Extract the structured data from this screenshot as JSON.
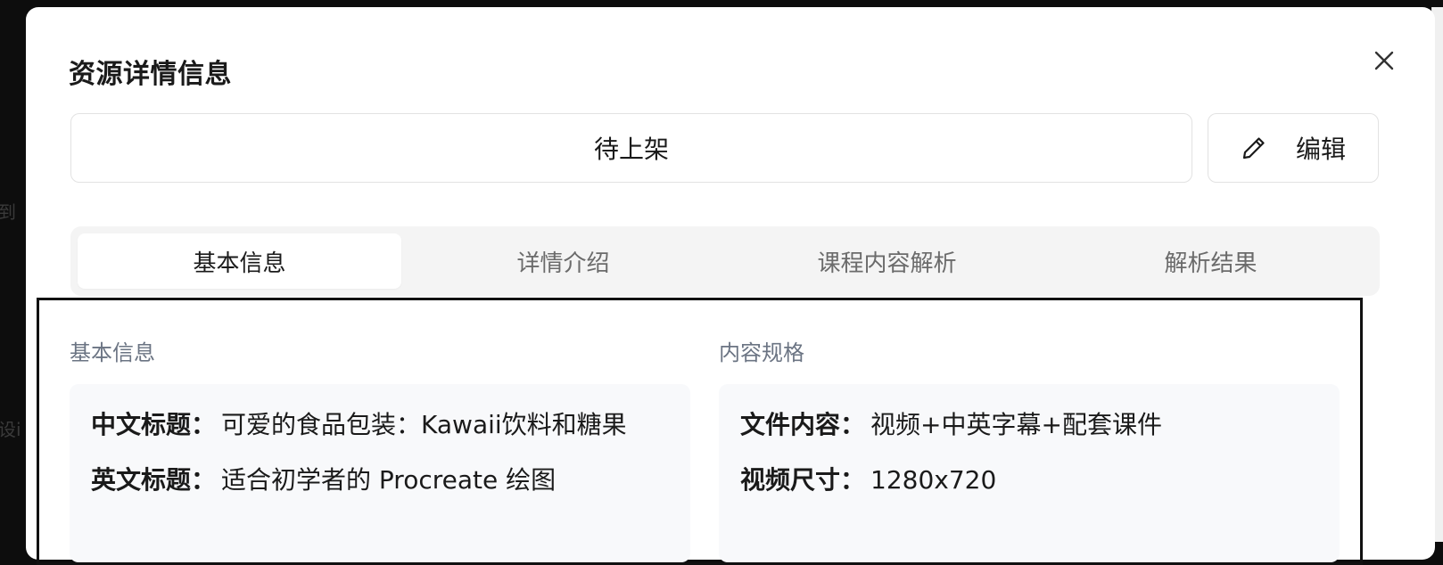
{
  "background_fragments": [
    "到",
    "设i"
  ],
  "dialog": {
    "title": "资源详情信息",
    "close_icon": "close-icon",
    "status": "待上架",
    "edit_button": {
      "label": "编辑",
      "icon": "pencil-icon"
    }
  },
  "tabs": [
    {
      "label": "基本信息",
      "active": true
    },
    {
      "label": "详情介绍",
      "active": false
    },
    {
      "label": "课程内容解析",
      "active": false
    },
    {
      "label": "解析结果",
      "active": false
    }
  ],
  "basic_info": {
    "section_title": "基本信息",
    "fields": [
      {
        "key": "中文标题：",
        "value": "可爱的食品包装：Kawaii饮料和糖果"
      },
      {
        "key": "英文标题：",
        "value": "适合初学者的 Procreate 绘图"
      }
    ]
  },
  "content_spec": {
    "section_title": "内容规格",
    "fields": [
      {
        "key": "文件内容：",
        "value": "视频+中英字幕+配套课件"
      },
      {
        "key": "视频尺寸：",
        "value": "1280x720"
      }
    ]
  },
  "colors": {
    "accent_frame": "#111111",
    "muted_label": "#6b7483",
    "card_bg": "#f8f9fb"
  }
}
